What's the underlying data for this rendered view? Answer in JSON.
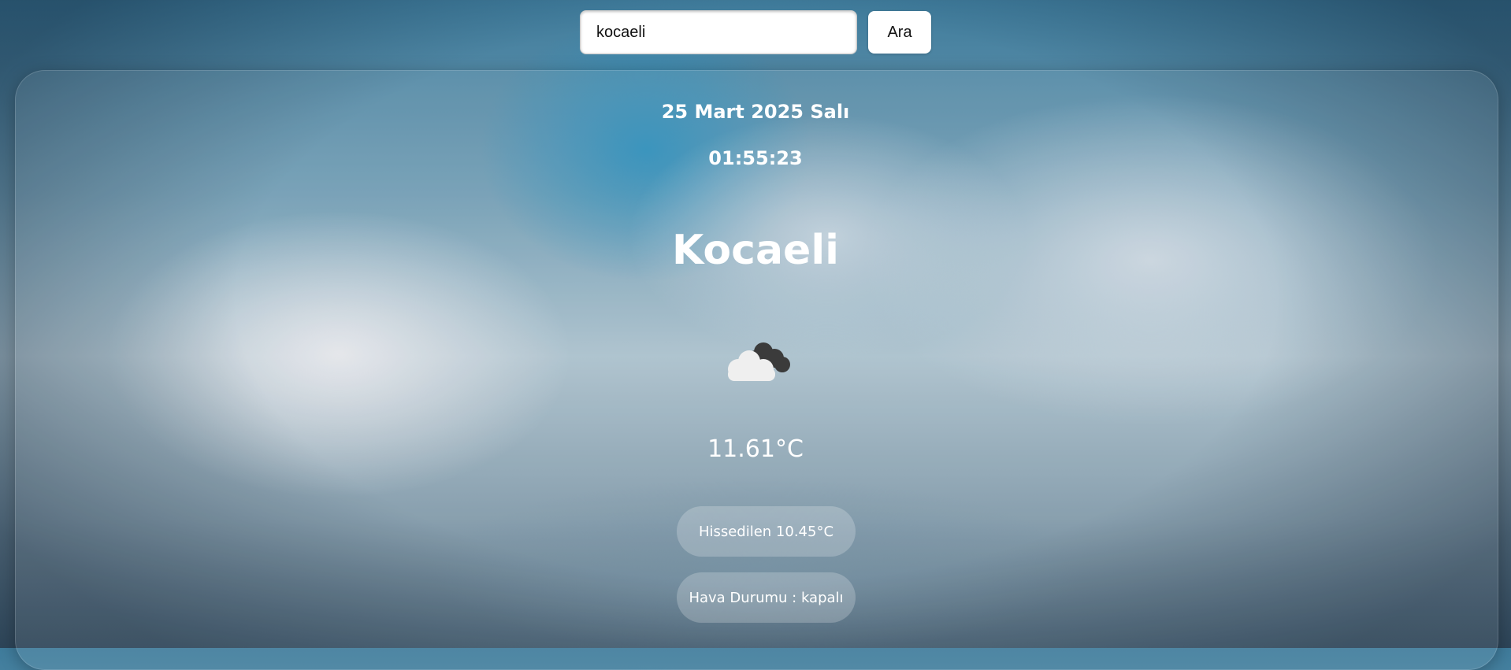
{
  "search": {
    "value": "kocaeli",
    "button_label": "Ara"
  },
  "weather": {
    "date": "25 Mart 2025 Salı",
    "time": "01:55:23",
    "city": "Kocaeli",
    "icon": "cloud-icon",
    "temperature": "11.61°C",
    "feels_like": "Hissedilen 10.45°C",
    "description": "Hava Durumu : kapalı"
  }
}
